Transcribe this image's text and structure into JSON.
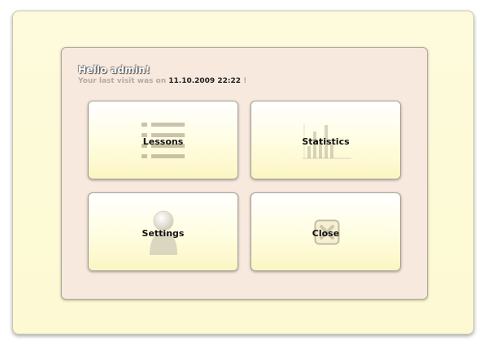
{
  "welcome": {
    "greeting": "Hello admin!",
    "last_visit_prefix": "Your last visit was on",
    "last_visit_datetime": "11.10.2009 22:22",
    "last_visit_suffix": "!"
  },
  "menu": {
    "lessons_label": "Lessons",
    "statistics_label": "Statistics",
    "settings_label": "Settings",
    "close_label": "Close"
  },
  "icons": {
    "lessons": "list-icon",
    "statistics": "bar-chart-icon",
    "settings": "user-icon",
    "close": "close-icon"
  },
  "colors": {
    "outer_background": "#fdfbdc",
    "panel_background": "#f8e9de",
    "tile_gradient_bottom": "#fcf5c3",
    "muted_text": "#b6aaa0"
  }
}
